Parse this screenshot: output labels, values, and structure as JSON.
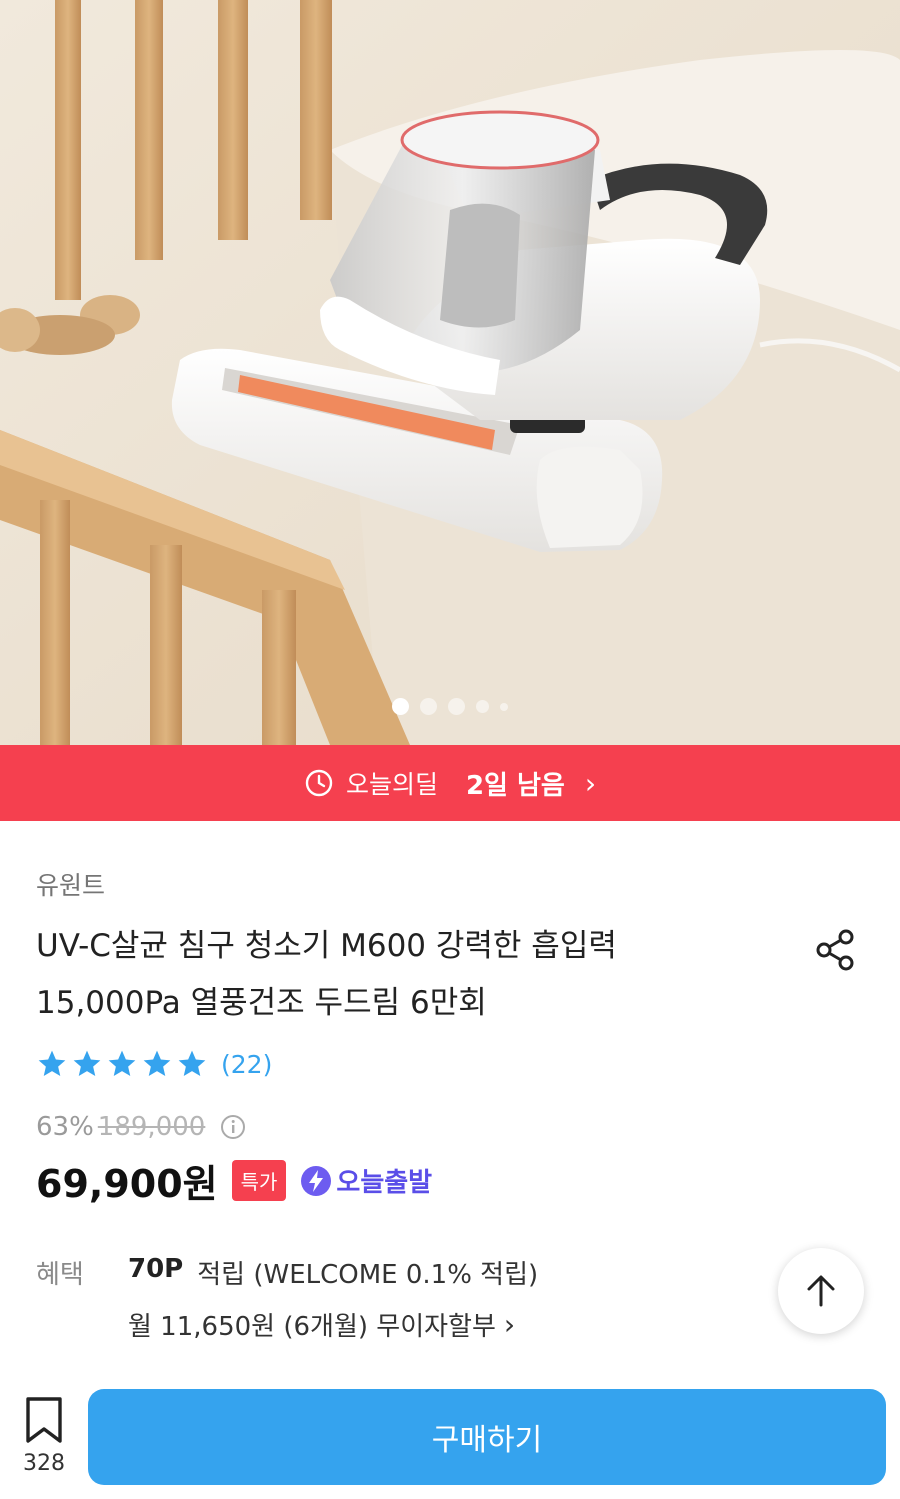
{
  "hero": {
    "image_name": "product-photo-vacuum",
    "slide_count": 5,
    "active_slide": 1
  },
  "deal": {
    "icon": "clock-icon",
    "label": "오늘의딜",
    "remaining": "2일 남음",
    "chevron": "›",
    "color": "#f5404f"
  },
  "product": {
    "brand": "유원트",
    "title_line1": "UV-C살균 침구 청소기 M600 강력한 흡입력",
    "title_line2": "15,000Pa 열풍건조 두드림 6만회",
    "rating": 5,
    "review_count": "(22)",
    "discount": "63%",
    "original_price": "189,000",
    "price": "69,900원",
    "sale_badge": "특가",
    "shipping_badge": "오늘출발",
    "accent_color": "#35a3ee",
    "shipping_color": "#5a4ee8"
  },
  "benefits": {
    "label": "혜택",
    "points": "70P",
    "points_text": "적립 (WELCOME 0.1% 적립)",
    "installment": "월 11,650원 (6개월) 무이자할부",
    "chevron": "›"
  },
  "bottom": {
    "bookmark_count": "328",
    "buy_label": "구매하기"
  }
}
